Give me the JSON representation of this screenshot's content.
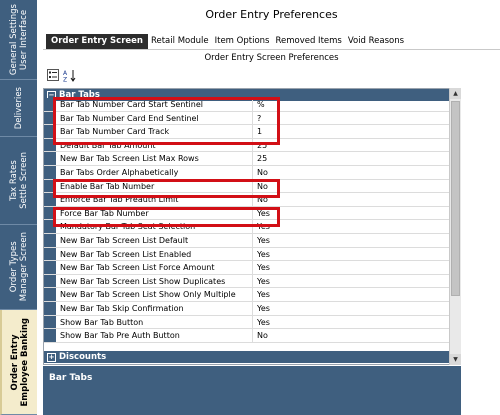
{
  "window": {
    "title": "Order Entry Preferences"
  },
  "left_tabs": [
    {
      "label": "General Settings\nUser Interface",
      "active": false
    },
    {
      "label": "Deliveries",
      "active": false
    },
    {
      "label": "Tax Rates\nSettle Screen",
      "active": false
    },
    {
      "label": "Order Types\nManager Screen",
      "active": false
    },
    {
      "label": "Order Entry\nEmployee Banking",
      "active": true
    }
  ],
  "tabs": [
    {
      "label": "Order Entry Screen",
      "active": true
    },
    {
      "label": "Retail Module",
      "active": false
    },
    {
      "label": "Item Options",
      "active": false
    },
    {
      "label": "Removed Items",
      "active": false
    },
    {
      "label": "Void Reasons",
      "active": false
    }
  ],
  "section_title": "Order Entry Screen Preferences",
  "toolbar": {
    "sort_categorized_icon": "categorized-icon",
    "sort_alpha_icon": "az-sort-icon"
  },
  "grid": {
    "category_bar_tabs": "Bar Tabs",
    "category_discounts": "Discounts",
    "rows": [
      {
        "name": "Bar Tab Number Card Start Sentinel",
        "value": "%"
      },
      {
        "name": "Bar Tab Number Card End Sentinel",
        "value": "?"
      },
      {
        "name": "Bar Tab Number Card Track",
        "value": "1"
      },
      {
        "name": "Default Bar Tab Amount",
        "value": "25"
      },
      {
        "name": "New Bar Tab Screen List Max Rows",
        "value": "25"
      },
      {
        "name": "Bar Tabs Order Alphabetically",
        "value": "No"
      },
      {
        "name": "Enable Bar Tab Number",
        "value": "No"
      },
      {
        "name": "Enforce Bar Tab Preauth Limit",
        "value": "No"
      },
      {
        "name": "Force Bar Tab Number",
        "value": "Yes"
      },
      {
        "name": "Mandatory Bar Tab Seat Selection",
        "value": "Yes"
      },
      {
        "name": "New Bar Tab Screen List Default",
        "value": "Yes"
      },
      {
        "name": "New Bar Tab Screen List Enabled",
        "value": "Yes"
      },
      {
        "name": "New Bar Tab Screen List Force Amount",
        "value": "Yes"
      },
      {
        "name": "New Bar Tab Screen List Show Duplicates",
        "value": "Yes"
      },
      {
        "name": "New Bar Tab Screen List Show Only Multiple",
        "value": "Yes"
      },
      {
        "name": "New Bar Tab Skip Confirmation",
        "value": "Yes"
      },
      {
        "name": "Show Bar Tab Button",
        "value": "Yes"
      },
      {
        "name": "Show Bar Tab Pre Auth Button",
        "value": "No"
      }
    ]
  },
  "description": {
    "title": "Bar Tabs"
  },
  "colors": {
    "accent": "#3f5f7f",
    "highlight": "#d20f16",
    "active_tab": "#2c2c2c"
  }
}
